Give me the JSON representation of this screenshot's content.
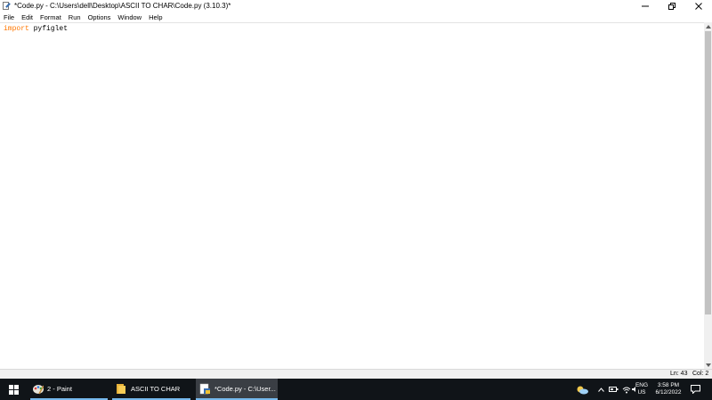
{
  "window": {
    "title": "*Code.py - C:\\Users\\dell\\Desktop\\ASCII TO CHAR\\Code.py (3.10.3)*",
    "icon": "idle-python-file-icon"
  },
  "menu": {
    "items": [
      {
        "label": "File"
      },
      {
        "label": "Edit"
      },
      {
        "label": "Format"
      },
      {
        "label": "Run"
      },
      {
        "label": "Options"
      },
      {
        "label": "Window"
      },
      {
        "label": "Help"
      }
    ]
  },
  "editor": {
    "lines": [
      {
        "keyword": "import",
        "rest": " pyfiglet"
      }
    ],
    "colors": {
      "keyword": "#ff7700",
      "text": "#000000"
    }
  },
  "status": {
    "ln": "Ln: 43",
    "col": "Col: 2"
  },
  "taskbar": {
    "tasks": [
      {
        "label": "2 - Paint",
        "icon": "paint-icon"
      },
      {
        "label": "ASCII TO CHAR",
        "icon": "folder-icon"
      },
      {
        "label": "*Code.py - C:\\User...",
        "icon": "idle-icon"
      }
    ],
    "tray": {
      "lang_top": "ENG",
      "lang_bottom": "US",
      "time": "3:58 PM",
      "date": "6/12/2022"
    },
    "accent": "#76b9ed",
    "background": "#101418"
  }
}
